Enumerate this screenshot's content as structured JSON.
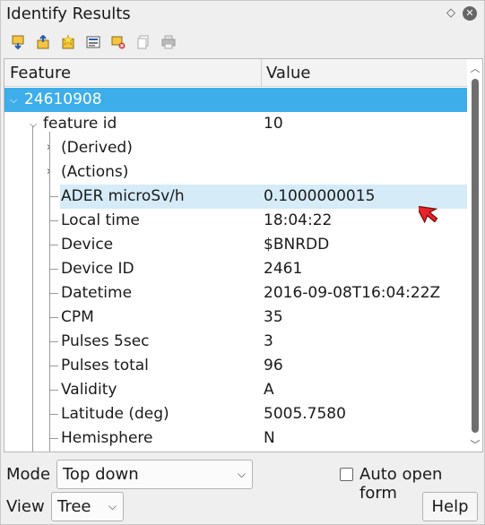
{
  "window": {
    "title": "Identify Results"
  },
  "toolbar": {
    "icons": [
      "expand-all-icon",
      "collapse-all-icon",
      "expand-new-icon",
      "open-form-icon",
      "clear-results-icon",
      "copy-feature-icon",
      "print-icon"
    ]
  },
  "tree": {
    "columns": [
      "Feature",
      "Value"
    ],
    "root": "24610908",
    "node": {
      "label": "feature id",
      "value": "10"
    },
    "groups": [
      "(Derived)",
      "(Actions)"
    ],
    "attributes": [
      {
        "key": "ADER microSv/h",
        "value": "0.1000000015"
      },
      {
        "key": "Local time",
        "value": "18:04:22"
      },
      {
        "key": "Device",
        "value": "$BNRDD"
      },
      {
        "key": "Device ID",
        "value": "2461"
      },
      {
        "key": "Datetime",
        "value": "2016-09-08T16:04:22Z"
      },
      {
        "key": "CPM",
        "value": "35"
      },
      {
        "key": "Pulses 5sec",
        "value": "3"
      },
      {
        "key": "Pulses total",
        "value": "96"
      },
      {
        "key": "Validity",
        "value": "A"
      },
      {
        "key": "Latitude (deg)",
        "value": "5005.7580"
      },
      {
        "key": "Hemisphere",
        "value": "N"
      }
    ]
  },
  "footer": {
    "mode_label": "Mode",
    "mode_value": "Top down",
    "auto_open_label": "Auto open form",
    "view_label": "View",
    "view_value": "Tree",
    "help_label": "Help"
  },
  "colors": {
    "selection": "#3daee9",
    "hover_row": "#d6ebf8",
    "cursor": "#e8232a"
  }
}
